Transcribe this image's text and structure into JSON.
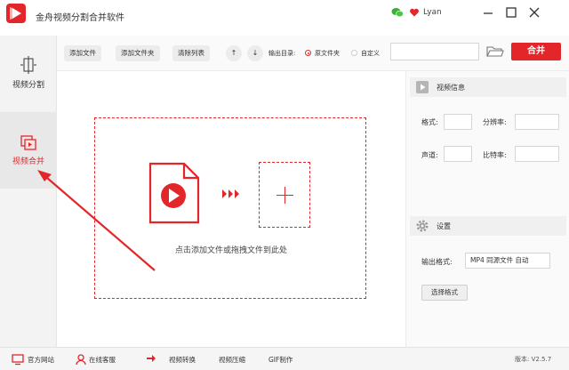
{
  "app": {
    "title": "金舟视频分割合并软件",
    "username": "Lyan"
  },
  "icons": {
    "logo": "play-logo-icon",
    "wechat": "wechat-icon",
    "vip": "vip-heart-icon",
    "minimize": "minimize-icon",
    "maximize": "maximize-icon",
    "close": "close-icon"
  },
  "sidebar": {
    "items": [
      {
        "label": "视频分割",
        "icon": "split-icon",
        "active": false
      },
      {
        "label": "视频合并",
        "icon": "merge-icon",
        "active": true
      }
    ]
  },
  "toolbar": {
    "add_file": "添加文件",
    "add_folder": "添加文件夹",
    "clear_list": "清除列表",
    "move_up": "↑",
    "move_down": "↓",
    "output_label": "输出目录:",
    "output_options": [
      {
        "label": "原文件夹",
        "selected": true
      },
      {
        "label": "自定义",
        "selected": false
      }
    ],
    "output_path_value": "",
    "merge_button": "合并"
  },
  "main": {
    "drop_hint": "点击添加文件或拖拽文件到此处"
  },
  "video_info": {
    "title": "视频信息",
    "format_label": "格式:",
    "resolution_label": "分辨率:",
    "channel_label": "声道:",
    "bitrate_label": "比特率:"
  },
  "settings": {
    "title": "设置",
    "output_format_label": "输出格式:",
    "output_format_value": "MP4  同源文件  自动",
    "select_format_button": "选择格式"
  },
  "statusbar": {
    "official_site": "官方网站",
    "online_service": "在线客服",
    "video_convert": "视频转换",
    "video_compress": "视频压缩",
    "gif_make": "GIF制作",
    "version": "版本: V2.5.7"
  },
  "colors": {
    "accent": "#e3262a",
    "sidebar_bg": "#f3f3f3",
    "active_bg": "#e8e8e8"
  }
}
